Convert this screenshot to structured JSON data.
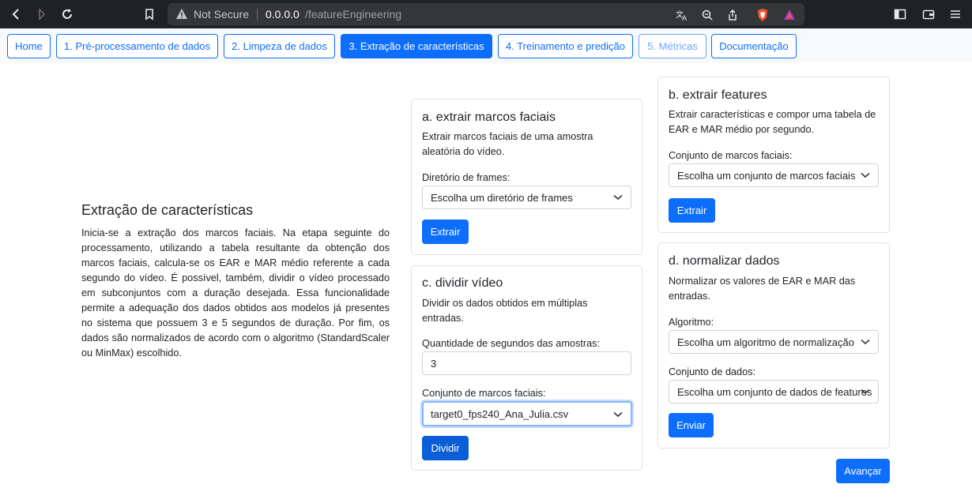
{
  "browser": {
    "security_label": "Not Secure",
    "url_host": "0.0.0.0",
    "url_path": "/featureEngineering",
    "icons": [
      "back-icon",
      "forward-icon",
      "reload-icon",
      "bookmark-icon",
      "warning-icon",
      "translate-icon",
      "zoom-icon",
      "share-icon",
      "brave-shield-icon",
      "brave-rewards-icon",
      "sidebar-icon",
      "wallet-icon"
    ]
  },
  "nav": {
    "items": [
      {
        "label": "Home",
        "state": "default"
      },
      {
        "label": "1. Pré-processamento de dados",
        "state": "default"
      },
      {
        "label": "2. Limpeza de dados",
        "state": "default"
      },
      {
        "label": "3. Extração de características",
        "state": "active"
      },
      {
        "label": "4. Treinamento e predição",
        "state": "default"
      },
      {
        "label": "5. Métricas",
        "state": "disabled"
      },
      {
        "label": "Documentação",
        "state": "default"
      }
    ]
  },
  "intro": {
    "title": "Extração de características",
    "text": "Inicia-se a extração dos marcos faciais. Na etapa seguinte do processamento, utilizando a tabela resultante da obtenção dos marcos faciais, calcula-se os EAR e MAR médio referente a cada segundo do vídeo. É possível, também, dividir o vídeo processado em subconjuntos com a duração desejada. Essa funcionalidade permite a adequação dos dados obtidos aos modelos já presentes no sistema que possuem 3 e 5 segundos de duração. Por fim, os dados são normalizados de acordo com o algoritmo (StandardScaler ou MinMax) escolhido."
  },
  "card_a": {
    "title": "a. extrair marcos faciais",
    "text": "Extrair marcos faciais de uma amostra aleatória do vídeo.",
    "field_label": "Diretório de frames:",
    "select_value": "Escolha um diretório de frames",
    "button": "Extrair"
  },
  "card_c": {
    "title": "c. dividir vídeo",
    "text": "Dividir os dados obtidos em múltiplas entradas.",
    "seconds_label": "Quantidade de segundos das amostras:",
    "seconds_value": "3",
    "landmarks_label": "Conjunto de marcos faciais:",
    "landmarks_value": "target0_fps240_Ana_Julia.csv",
    "button": "Dividir"
  },
  "card_b": {
    "title": "b. extrair features",
    "text": "Extrair características e compor uma tabela de EAR e MAR médio por segundo.",
    "field_label": "Conjunto de marcos faciais:",
    "select_value": "Escolha um conjunto de marcos faciais",
    "button": "Extrair"
  },
  "card_d": {
    "title": "d. normalizar dados",
    "text": "Normalizar os valores de EAR e MAR das entradas.",
    "algorithm_label": "Algoritmo:",
    "algorithm_value": "Escolha um algoritmo de normalização",
    "dataset_label": "Conjunto de dados:",
    "dataset_value": "Escolha um conjunto de dados de features",
    "button": "Enviar"
  },
  "advance_button": "Avançar",
  "colors": {
    "primary": "#0d6efd",
    "primary_dark": "#0b5ed7",
    "disabled": "#6ea8fe",
    "browser_chrome": "#202124",
    "navbar_bg": "#f8f9fa"
  }
}
